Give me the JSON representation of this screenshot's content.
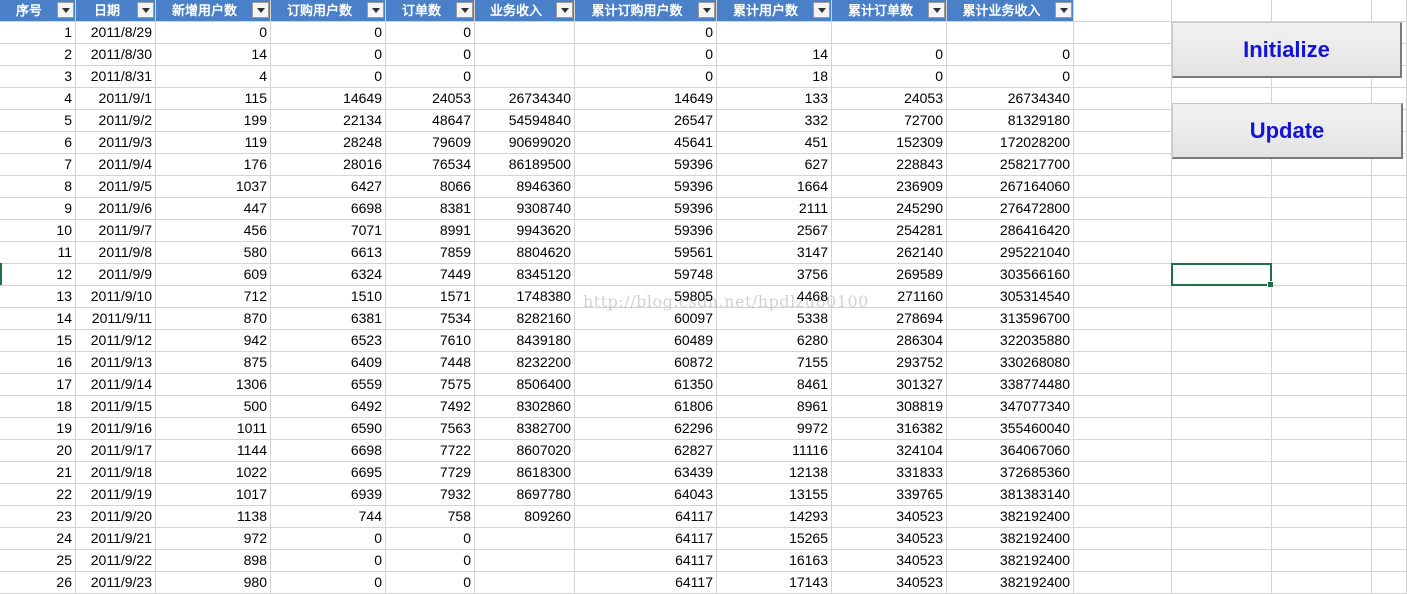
{
  "headers": [
    "序号",
    "日期",
    "新增用户数",
    "订购用户数",
    "订单数",
    "业务收入",
    "累计订购用户数",
    "累计用户数",
    "累计订单数",
    "累计业务收入"
  ],
  "rows": [
    [
      "1",
      "2011/8/29",
      "0",
      "0",
      "0",
      "",
      "0",
      "",
      "",
      ""
    ],
    [
      "2",
      "2011/8/30",
      "14",
      "0",
      "0",
      "",
      "0",
      "14",
      "0",
      "0"
    ],
    [
      "3",
      "2011/8/31",
      "4",
      "0",
      "0",
      "",
      "0",
      "18",
      "0",
      "0"
    ],
    [
      "4",
      "2011/9/1",
      "115",
      "14649",
      "24053",
      "26734340",
      "14649",
      "133",
      "24053",
      "26734340"
    ],
    [
      "5",
      "2011/9/2",
      "199",
      "22134",
      "48647",
      "54594840",
      "26547",
      "332",
      "72700",
      "81329180"
    ],
    [
      "6",
      "2011/9/3",
      "119",
      "28248",
      "79609",
      "90699020",
      "45641",
      "451",
      "152309",
      "172028200"
    ],
    [
      "7",
      "2011/9/4",
      "176",
      "28016",
      "76534",
      "86189500",
      "59396",
      "627",
      "228843",
      "258217700"
    ],
    [
      "8",
      "2011/9/5",
      "1037",
      "6427",
      "8066",
      "8946360",
      "59396",
      "1664",
      "236909",
      "267164060"
    ],
    [
      "9",
      "2011/9/6",
      "447",
      "6698",
      "8381",
      "9308740",
      "59396",
      "2111",
      "245290",
      "276472800"
    ],
    [
      "10",
      "2011/9/7",
      "456",
      "7071",
      "8991",
      "9943620",
      "59396",
      "2567",
      "254281",
      "286416420"
    ],
    [
      "11",
      "2011/9/8",
      "580",
      "6613",
      "7859",
      "8804620",
      "59561",
      "3147",
      "262140",
      "295221040"
    ],
    [
      "12",
      "2011/9/9",
      "609",
      "6324",
      "7449",
      "8345120",
      "59748",
      "3756",
      "269589",
      "303566160"
    ],
    [
      "13",
      "2011/9/10",
      "712",
      "1510",
      "1571",
      "1748380",
      "59805",
      "4468",
      "271160",
      "305314540"
    ],
    [
      "14",
      "2011/9/11",
      "870",
      "6381",
      "7534",
      "8282160",
      "60097",
      "5338",
      "278694",
      "313596700"
    ],
    [
      "15",
      "2011/9/12",
      "942",
      "6523",
      "7610",
      "8439180",
      "60489",
      "6280",
      "286304",
      "322035880"
    ],
    [
      "16",
      "2011/9/13",
      "875",
      "6409",
      "7448",
      "8232200",
      "60872",
      "7155",
      "293752",
      "330268080"
    ],
    [
      "17",
      "2011/9/14",
      "1306",
      "6559",
      "7575",
      "8506400",
      "61350",
      "8461",
      "301327",
      "338774480"
    ],
    [
      "18",
      "2011/9/15",
      "500",
      "6492",
      "7492",
      "8302860",
      "61806",
      "8961",
      "308819",
      "347077340"
    ],
    [
      "19",
      "2011/9/16",
      "1011",
      "6590",
      "7563",
      "8382700",
      "62296",
      "9972",
      "316382",
      "355460040"
    ],
    [
      "20",
      "2011/9/17",
      "1144",
      "6698",
      "7722",
      "8607020",
      "62827",
      "11116",
      "324104",
      "364067060"
    ],
    [
      "21",
      "2011/9/18",
      "1022",
      "6695",
      "7729",
      "8618300",
      "63439",
      "12138",
      "331833",
      "372685360"
    ],
    [
      "22",
      "2011/9/19",
      "1017",
      "6939",
      "7932",
      "8697780",
      "64043",
      "13155",
      "339765",
      "381383140"
    ],
    [
      "23",
      "2011/9/20",
      "1138",
      "744",
      "758",
      "809260",
      "64117",
      "14293",
      "340523",
      "382192400"
    ],
    [
      "24",
      "2011/9/21",
      "972",
      "0",
      "0",
      "",
      "64117",
      "15265",
      "340523",
      "382192400"
    ],
    [
      "25",
      "2011/9/22",
      "898",
      "0",
      "0",
      "",
      "64117",
      "16163",
      "340523",
      "382192400"
    ],
    [
      "26",
      "2011/9/23",
      "980",
      "0",
      "0",
      "",
      "64117",
      "17143",
      "340523",
      "382192400"
    ]
  ],
  "buttons": {
    "initialize": "Initialize",
    "update": "Update"
  },
  "watermark": "http://blog.csdn.net/hpdlzu80100",
  "colors": {
    "header_bg": "#4a80c8",
    "button_text": "#1212d8",
    "selection": "#1f7144"
  }
}
